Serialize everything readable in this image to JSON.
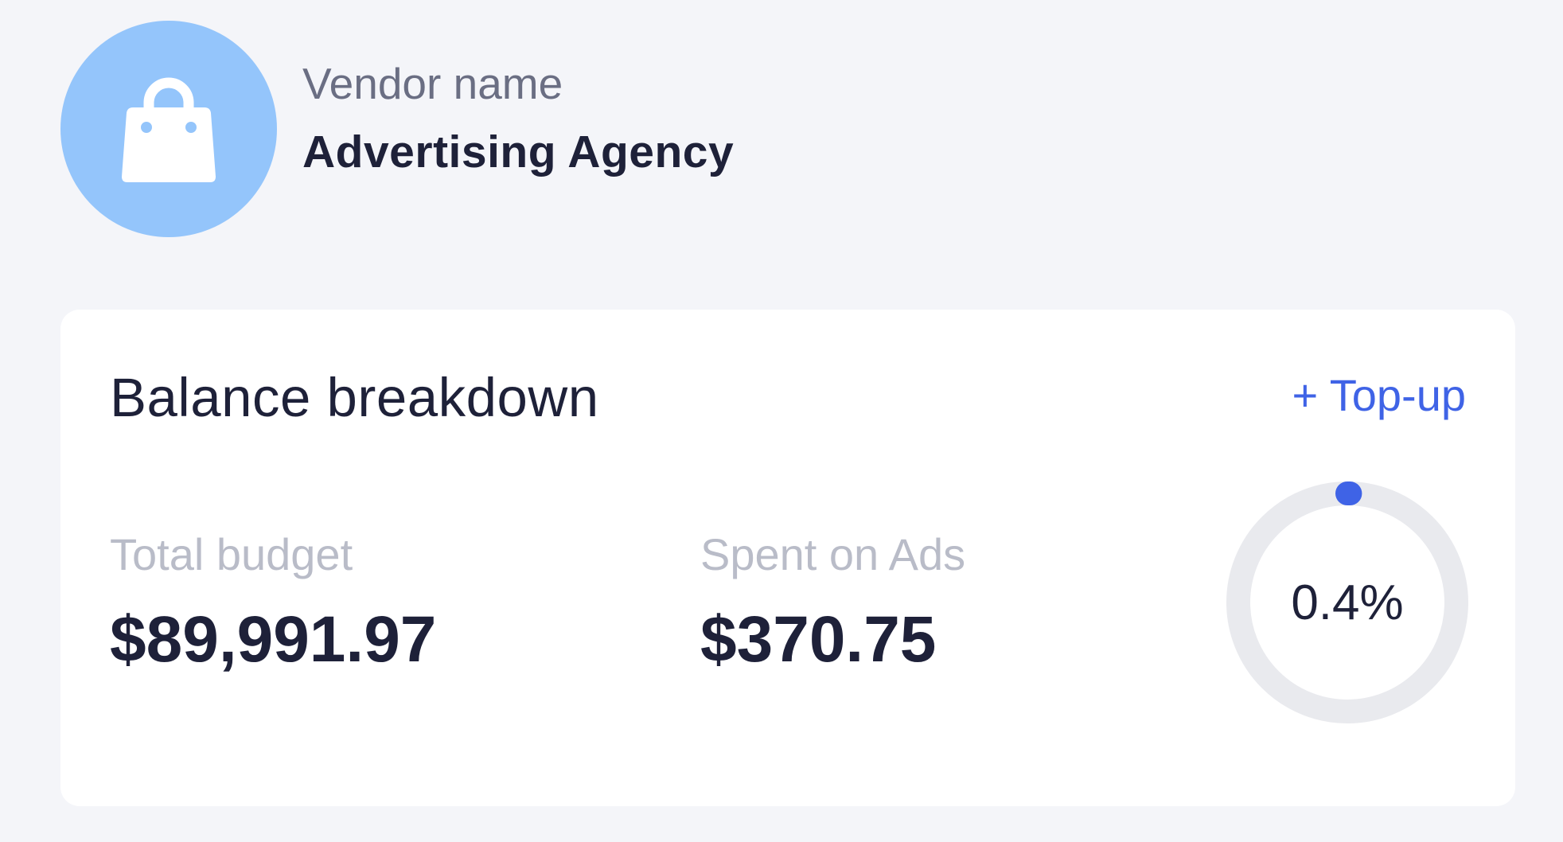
{
  "vendor": {
    "label": "Vendor name",
    "name": "Advertising Agency",
    "avatar_icon": "shopping-bag-icon",
    "avatar_color": "#94c5fb"
  },
  "balance": {
    "title": "Balance breakdown",
    "topup_label": "+ Top-up",
    "total_budget": {
      "label": "Total budget",
      "value": "$89,991.97"
    },
    "spent_on_ads": {
      "label": "Spent on Ads",
      "value": "$370.75"
    },
    "progress": {
      "display": "0.4%",
      "fraction": 0.004,
      "track_color": "#e9eaee",
      "indicator_color": "#3f63e6"
    }
  }
}
